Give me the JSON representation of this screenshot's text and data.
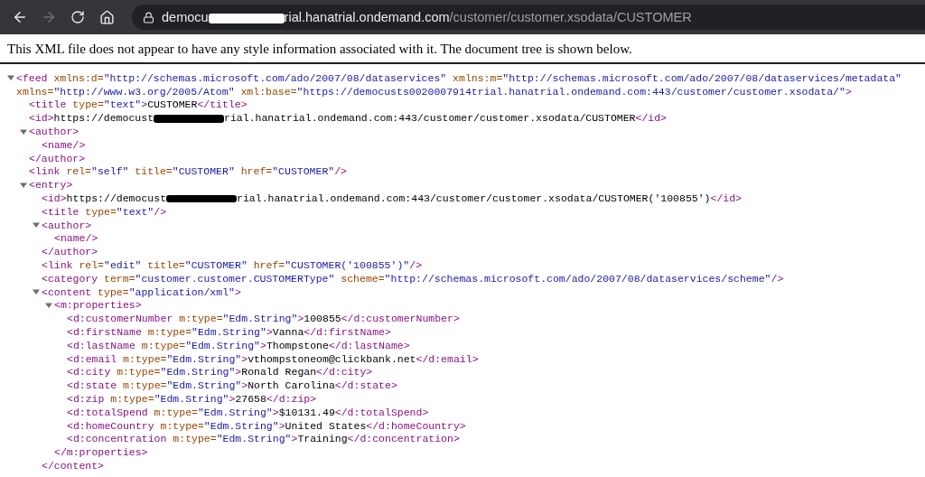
{
  "browser": {
    "nav": [
      {
        "kind": "back",
        "disabled": false
      },
      {
        "kind": "forward",
        "disabled": true
      },
      {
        "kind": "reload",
        "disabled": false
      },
      {
        "kind": "home",
        "disabled": false
      }
    ],
    "url": [
      {
        "kind": "host",
        "text": "democu"
      },
      {
        "kind": "redaction"
      },
      {
        "kind": "host",
        "text": "rial.hanatrial.ondemand.com"
      },
      {
        "kind": "path",
        "text": "/customer/customer.xsodata/CUSTOMER"
      }
    ]
  },
  "notice": "This XML file does not appear to have any style information associated with it. The document tree is shown below.",
  "xml": [
    {
      "expanded": true,
      "tokens": [
        {
          "kind": "tag",
          "text": "<feed"
        },
        {
          "kind": "attr",
          "text": " xmlns:d="
        },
        {
          "kind": "value",
          "text": "\"http://schemas.microsoft.com/ado/2007/08/dataservices\""
        },
        {
          "kind": "attr",
          "text": " xmlns:m="
        },
        {
          "kind": "value",
          "text": "\"http://schemas.microsoft.com/ado/2007/08/dataservices/metadata\""
        }
      ],
      "continuation": [
        {
          "kind": "attr",
          "text": "xmlns="
        },
        {
          "kind": "value",
          "text": "\"http://www.w3.org/2005/Atom\""
        },
        {
          "kind": "attr",
          "text": " xml:base="
        },
        {
          "kind": "value",
          "text": "\"https://democusts0020007914trial.hanatrial.ondemand.com:443/customer/customer.xsodata/\""
        },
        {
          "kind": "tag",
          "text": ">"
        }
      ],
      "children": [
        {
          "tokens": [
            {
              "kind": "tag",
              "text": "<title"
            },
            {
              "kind": "attr",
              "text": " type="
            },
            {
              "kind": "value",
              "text": "\"text\""
            },
            {
              "kind": "tag",
              "text": ">"
            },
            {
              "kind": "text",
              "text": "CUSTOMER"
            },
            {
              "kind": "tag",
              "text": "</title>"
            }
          ]
        },
        {
          "tokens": [
            {
              "kind": "tag",
              "text": "<id>"
            },
            {
              "kind": "text",
              "text": "https://democust"
            },
            {
              "kind": "redaction"
            },
            {
              "kind": "text",
              "text": "rial.hanatrial.ondemand.com:443/customer/customer.xsodata/CUSTOMER"
            },
            {
              "kind": "tag",
              "text": "</id>"
            }
          ]
        },
        {
          "expanded": true,
          "tokens": [
            {
              "kind": "tag",
              "text": "<author>"
            }
          ],
          "children": [
            {
              "tokens": [
                {
                  "kind": "tag",
                  "text": "<name/>"
                }
              ]
            }
          ],
          "close": [
            {
              "kind": "tag",
              "text": "</author>"
            }
          ]
        },
        {
          "tokens": [
            {
              "kind": "tag",
              "text": "<link"
            },
            {
              "kind": "attr",
              "text": " rel="
            },
            {
              "kind": "value",
              "text": "\"self\""
            },
            {
              "kind": "attr",
              "text": " title="
            },
            {
              "kind": "value",
              "text": "\"CUSTOMER\""
            },
            {
              "kind": "attr",
              "text": " href="
            },
            {
              "kind": "value",
              "text": "\"CUSTOMER\""
            },
            {
              "kind": "tag",
              "text": "/>"
            }
          ]
        },
        {
          "expanded": true,
          "tokens": [
            {
              "kind": "tag",
              "text": "<entry>"
            }
          ],
          "children": [
            {
              "tokens": [
                {
                  "kind": "tag",
                  "text": "<id>"
                },
                {
                  "kind": "text",
                  "text": "https://democust"
                },
                {
                  "kind": "redaction"
                },
                {
                  "kind": "text",
                  "text": "rial.hanatrial.ondemand.com:443/customer/customer.xsodata/CUSTOMER('100855')"
                },
                {
                  "kind": "tag",
                  "text": "</id>"
                }
              ]
            },
            {
              "tokens": [
                {
                  "kind": "tag",
                  "text": "<title"
                },
                {
                  "kind": "attr",
                  "text": " type="
                },
                {
                  "kind": "value",
                  "text": "\"text\""
                },
                {
                  "kind": "tag",
                  "text": "/>"
                }
              ]
            },
            {
              "expanded": true,
              "tokens": [
                {
                  "kind": "tag",
                  "text": "<author>"
                }
              ],
              "children": [
                {
                  "tokens": [
                    {
                      "kind": "tag",
                      "text": "<name/>"
                    }
                  ]
                }
              ],
              "close": [
                {
                  "kind": "tag",
                  "text": "</author>"
                }
              ]
            },
            {
              "tokens": [
                {
                  "kind": "tag",
                  "text": "<link"
                },
                {
                  "kind": "attr",
                  "text": " rel="
                },
                {
                  "kind": "value",
                  "text": "\"edit\""
                },
                {
                  "kind": "attr",
                  "text": " title="
                },
                {
                  "kind": "value",
                  "text": "\"CUSTOMER\""
                },
                {
                  "kind": "attr",
                  "text": " href="
                },
                {
                  "kind": "value",
                  "text": "\"CUSTOMER('100855')\""
                },
                {
                  "kind": "tag",
                  "text": "/>"
                }
              ]
            },
            {
              "tokens": [
                {
                  "kind": "tag",
                  "text": "<category"
                },
                {
                  "kind": "attr",
                  "text": " term="
                },
                {
                  "kind": "value",
                  "text": "\"customer.customer.CUSTOMERType\""
                },
                {
                  "kind": "attr",
                  "text": " scheme="
                },
                {
                  "kind": "value",
                  "text": "\"http://schemas.microsoft.com/ado/2007/08/dataservices/scheme\""
                },
                {
                  "kind": "tag",
                  "text": "/>"
                }
              ]
            },
            {
              "expanded": true,
              "tokens": [
                {
                  "kind": "tag",
                  "text": "<content"
                },
                {
                  "kind": "attr",
                  "text": " type="
                },
                {
                  "kind": "value",
                  "text": "\"application/xml\""
                },
                {
                  "kind": "tag",
                  "text": ">"
                }
              ],
              "children": [
                {
                  "expanded": true,
                  "tokens": [
                    {
                      "kind": "tag",
                      "text": "<m:properties>"
                    }
                  ],
                  "children": [
                    {
                      "tokens": [
                        {
                          "kind": "tag",
                          "text": "<d:customerNumber"
                        },
                        {
                          "kind": "attr",
                          "text": " m:type="
                        },
                        {
                          "kind": "value",
                          "text": "\"Edm.String\""
                        },
                        {
                          "kind": "tag",
                          "text": ">"
                        },
                        {
                          "kind": "text",
                          "text": "100855"
                        },
                        {
                          "kind": "tag",
                          "text": "</d:customerNumber>"
                        }
                      ]
                    },
                    {
                      "tokens": [
                        {
                          "kind": "tag",
                          "text": "<d:firstName"
                        },
                        {
                          "kind": "attr",
                          "text": " m:type="
                        },
                        {
                          "kind": "value",
                          "text": "\"Edm.String\""
                        },
                        {
                          "kind": "tag",
                          "text": ">"
                        },
                        {
                          "kind": "text",
                          "text": "Vanna"
                        },
                        {
                          "kind": "tag",
                          "text": "</d:firstName>"
                        }
                      ]
                    },
                    {
                      "tokens": [
                        {
                          "kind": "tag",
                          "text": "<d:lastName"
                        },
                        {
                          "kind": "attr",
                          "text": " m:type="
                        },
                        {
                          "kind": "value",
                          "text": "\"Edm.String\""
                        },
                        {
                          "kind": "tag",
                          "text": ">"
                        },
                        {
                          "kind": "text",
                          "text": "Thompstone"
                        },
                        {
                          "kind": "tag",
                          "text": "</d:lastName>"
                        }
                      ]
                    },
                    {
                      "tokens": [
                        {
                          "kind": "tag",
                          "text": "<d:email"
                        },
                        {
                          "kind": "attr",
                          "text": " m:type="
                        },
                        {
                          "kind": "value",
                          "text": "\"Edm.String\""
                        },
                        {
                          "kind": "tag",
                          "text": ">"
                        },
                        {
                          "kind": "text",
                          "text": "vthompstoneom@clickbank.net"
                        },
                        {
                          "kind": "tag",
                          "text": "</d:email>"
                        }
                      ]
                    },
                    {
                      "tokens": [
                        {
                          "kind": "tag",
                          "text": "<d:city"
                        },
                        {
                          "kind": "attr",
                          "text": " m:type="
                        },
                        {
                          "kind": "value",
                          "text": "\"Edm.String\""
                        },
                        {
                          "kind": "tag",
                          "text": ">"
                        },
                        {
                          "kind": "text",
                          "text": "Ronald Regan"
                        },
                        {
                          "kind": "tag",
                          "text": "</d:city>"
                        }
                      ]
                    },
                    {
                      "tokens": [
                        {
                          "kind": "tag",
                          "text": "<d:state"
                        },
                        {
                          "kind": "attr",
                          "text": " m:type="
                        },
                        {
                          "kind": "value",
                          "text": "\"Edm.String\""
                        },
                        {
                          "kind": "tag",
                          "text": ">"
                        },
                        {
                          "kind": "text",
                          "text": "North Carolina"
                        },
                        {
                          "kind": "tag",
                          "text": "</d:state>"
                        }
                      ]
                    },
                    {
                      "tokens": [
                        {
                          "kind": "tag",
                          "text": "<d:zip"
                        },
                        {
                          "kind": "attr",
                          "text": " m:type="
                        },
                        {
                          "kind": "value",
                          "text": "\"Edm.String\""
                        },
                        {
                          "kind": "tag",
                          "text": ">"
                        },
                        {
                          "kind": "text",
                          "text": "27658"
                        },
                        {
                          "kind": "tag",
                          "text": "</d:zip>"
                        }
                      ]
                    },
                    {
                      "tokens": [
                        {
                          "kind": "tag",
                          "text": "<d:totalSpend"
                        },
                        {
                          "kind": "attr",
                          "text": " m:type="
                        },
                        {
                          "kind": "value",
                          "text": "\"Edm.String\""
                        },
                        {
                          "kind": "tag",
                          "text": ">"
                        },
                        {
                          "kind": "text",
                          "text": "$10131.49"
                        },
                        {
                          "kind": "tag",
                          "text": "</d:totalSpend>"
                        }
                      ]
                    },
                    {
                      "tokens": [
                        {
                          "kind": "tag",
                          "text": "<d:homeCountry"
                        },
                        {
                          "kind": "attr",
                          "text": " m:type="
                        },
                        {
                          "kind": "value",
                          "text": "\"Edm.String\""
                        },
                        {
                          "kind": "tag",
                          "text": ">"
                        },
                        {
                          "kind": "text",
                          "text": "United States"
                        },
                        {
                          "kind": "tag",
                          "text": "</d:homeCountry>"
                        }
                      ]
                    },
                    {
                      "tokens": [
                        {
                          "kind": "tag",
                          "text": "<d:concentration"
                        },
                        {
                          "kind": "attr",
                          "text": " m:type="
                        },
                        {
                          "kind": "value",
                          "text": "\"Edm.String\""
                        },
                        {
                          "kind": "tag",
                          "text": ">"
                        },
                        {
                          "kind": "text",
                          "text": "Training"
                        },
                        {
                          "kind": "tag",
                          "text": "</d:concentration>"
                        }
                      ]
                    }
                  ],
                  "close": [
                    {
                      "kind": "tag",
                      "text": "</m:properties>"
                    }
                  ]
                }
              ],
              "close": [
                {
                  "kind": "tag",
                  "text": "</content>"
                }
              ]
            }
          ]
        }
      ]
    }
  ]
}
